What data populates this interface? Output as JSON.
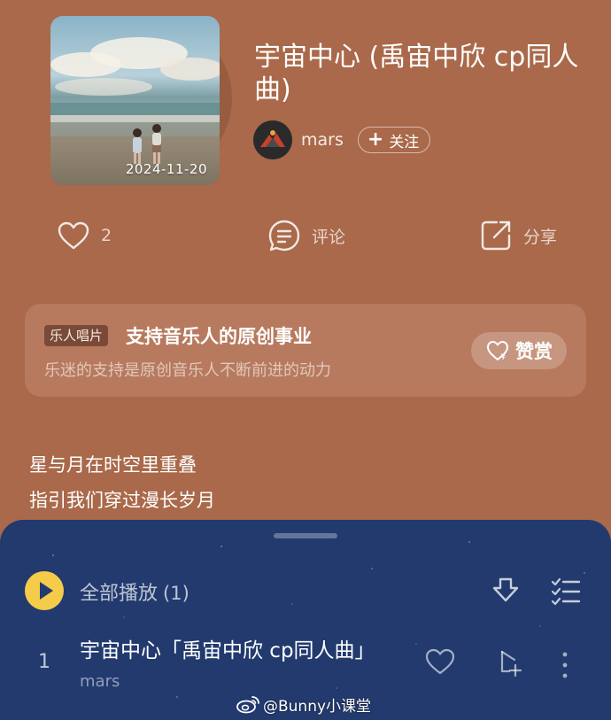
{
  "song": {
    "title": "宇宙中心 (禹宙中欣 cp同人曲)",
    "cover_date": "2024-11-20",
    "artist": "mars",
    "follow_label": "关注"
  },
  "actions": {
    "like_icon": "heart-icon",
    "like_count": "2",
    "comment_icon": "comment-icon",
    "comment_label": "评论",
    "share_icon": "share-icon",
    "share_label": "分享"
  },
  "support": {
    "tag": "乐人唱片",
    "title": "支持音乐人的原创事业",
    "subtitle": "乐迷的支持是原创音乐人不断前进的动力",
    "tip_icon": "heart-yen-icon",
    "tip_label": "赞赏"
  },
  "lyrics": [
    "星与月在时空里重叠",
    "指引我们穿过漫长岁月"
  ],
  "player": {
    "play_all_label": "全部播放",
    "play_all_count": "(1)",
    "tracks": [
      {
        "index": "1",
        "title": "宇宙中心「禹宙中欣 cp同人曲」",
        "artist": "mars"
      }
    ]
  },
  "watermark": {
    "icon": "weibo-icon",
    "text": "@Bunny小课堂"
  },
  "colors": {
    "background": "#a9694a",
    "card": "#b77a5e",
    "player": "#223a6e",
    "play_button": "#f5cc4a"
  }
}
